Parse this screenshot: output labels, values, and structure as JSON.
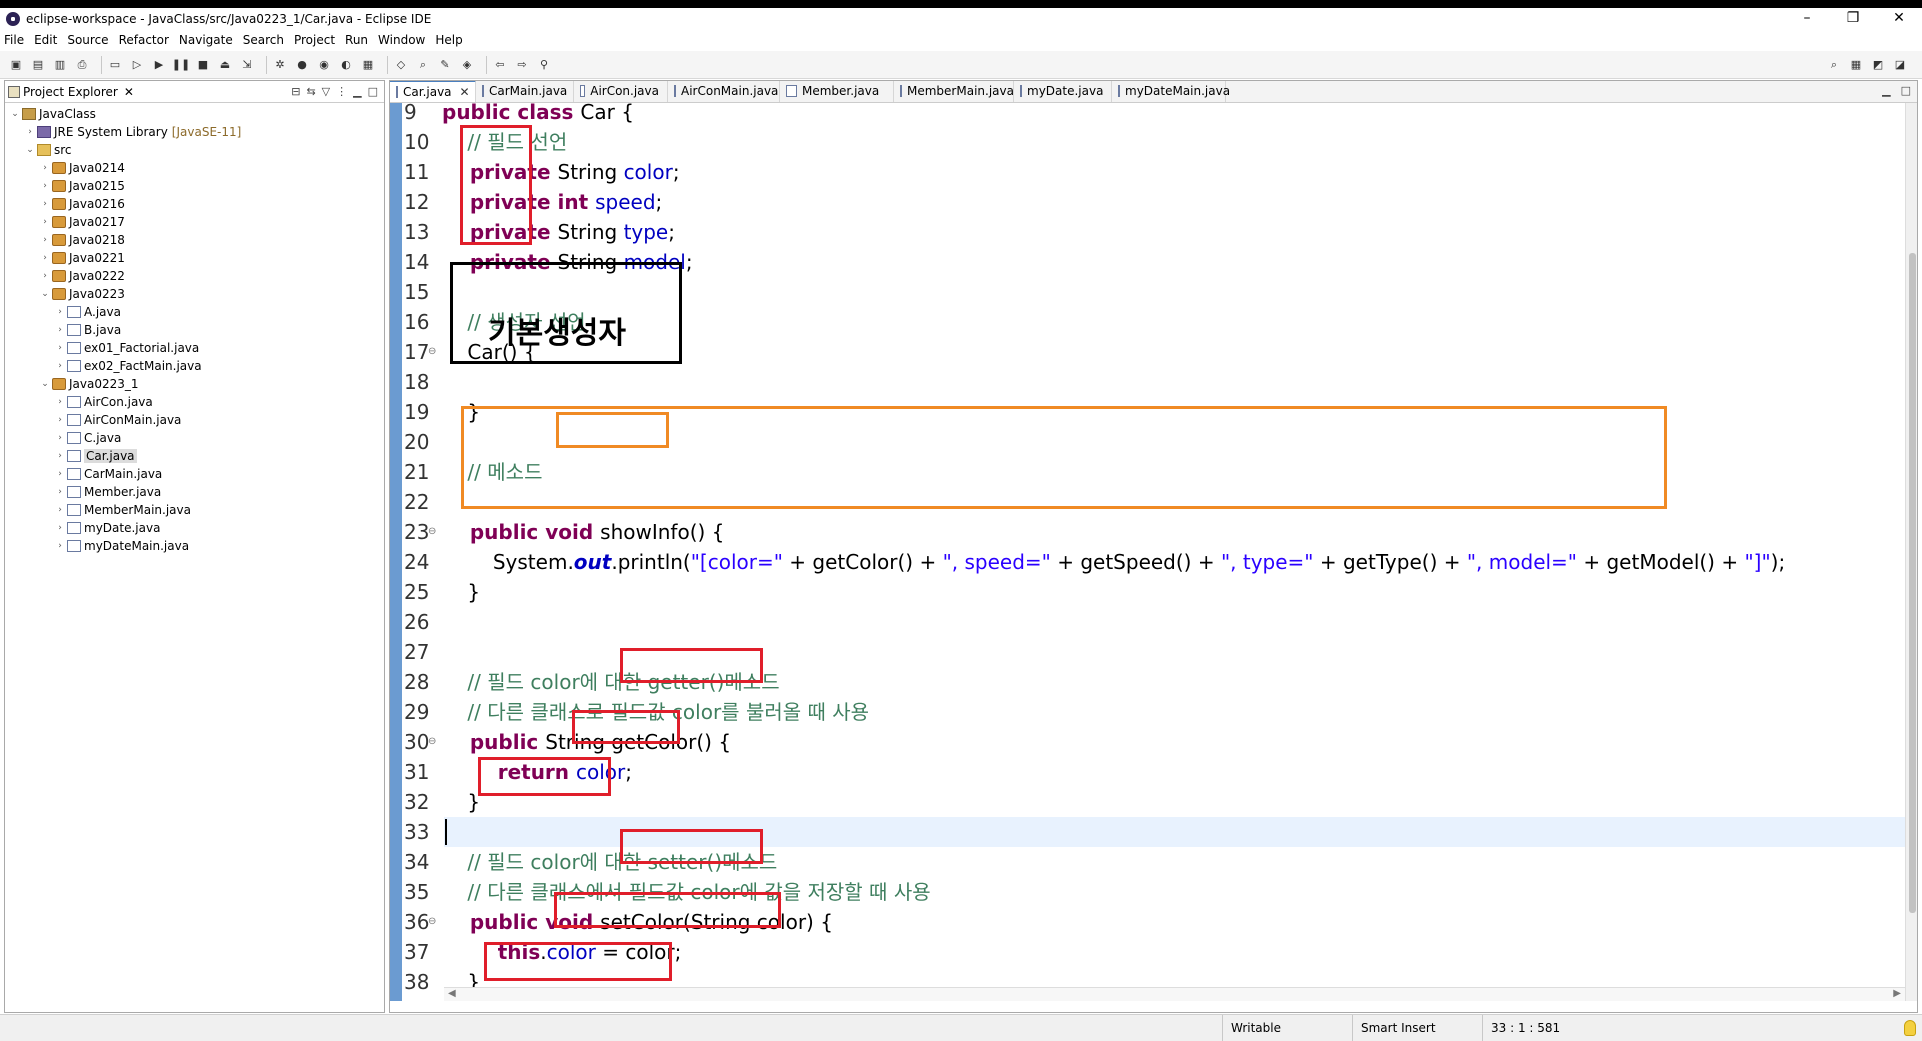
{
  "window": {
    "title": "eclipse-workspace - JavaClass/src/Java0223_1/Car.java - Eclipse IDE",
    "minimize": "–",
    "maximize": "❐",
    "close": "✕"
  },
  "menu": [
    "File",
    "Edit",
    "Source",
    "Refactor",
    "Navigate",
    "Search",
    "Project",
    "Run",
    "Window",
    "Help"
  ],
  "toolbar_icons": [
    "new-icon",
    "save-icon",
    "save-all-icon",
    "print-icon",
    "terminal-icon",
    "skip-icon",
    "resume-icon",
    "suspend-icon",
    "terminate-icon",
    "disconnect-icon",
    "step-icon",
    "debug-icon",
    "run-icon",
    "coverage-icon",
    "external-tools-icon",
    "new-java-project-icon",
    "open-type-icon",
    "search-icon",
    "toggle-mark-icon",
    "annotation-icon",
    "back-icon",
    "forward-icon",
    "pin-icon"
  ],
  "explorer": {
    "title": "Project Explorer",
    "tree": [
      {
        "label": "JavaClass",
        "depth": 0,
        "icon": "proj",
        "arrow": "v"
      },
      {
        "label": "JRE System Library",
        "decor": "[JavaSE-11]",
        "depth": 1,
        "icon": "lib",
        "arrow": ">"
      },
      {
        "label": "src",
        "depth": 1,
        "icon": "folder",
        "arrow": "v"
      },
      {
        "label": "Java0214",
        "depth": 2,
        "icon": "pkg",
        "arrow": ">"
      },
      {
        "label": "Java0215",
        "depth": 2,
        "icon": "pkg",
        "arrow": ">"
      },
      {
        "label": "Java0216",
        "depth": 2,
        "icon": "pkg",
        "arrow": ">"
      },
      {
        "label": "Java0217",
        "depth": 2,
        "icon": "pkg",
        "arrow": ">"
      },
      {
        "label": "Java0218",
        "depth": 2,
        "icon": "pkg",
        "arrow": ">"
      },
      {
        "label": "Java0221",
        "depth": 2,
        "icon": "pkg",
        "arrow": ">"
      },
      {
        "label": "Java0222",
        "depth": 2,
        "icon": "pkg",
        "arrow": ">"
      },
      {
        "label": "Java0223",
        "depth": 2,
        "icon": "pkg",
        "arrow": "v"
      },
      {
        "label": "A.java",
        "depth": 3,
        "icon": "jfile",
        "arrow": ">"
      },
      {
        "label": "B.java",
        "depth": 3,
        "icon": "jfile",
        "arrow": ">"
      },
      {
        "label": "ex01_Factorial.java",
        "depth": 3,
        "icon": "jfile",
        "arrow": ">"
      },
      {
        "label": "ex02_FactMain.java",
        "depth": 3,
        "icon": "jfile",
        "arrow": ">"
      },
      {
        "label": "Java0223_1",
        "depth": 2,
        "icon": "pkg",
        "arrow": "v"
      },
      {
        "label": "AirCon.java",
        "depth": 3,
        "icon": "jfile",
        "arrow": ">"
      },
      {
        "label": "AirConMain.java",
        "depth": 3,
        "icon": "jfile",
        "arrow": ">"
      },
      {
        "label": "C.java",
        "depth": 3,
        "icon": "jfile",
        "arrow": ">"
      },
      {
        "label": "Car.java",
        "depth": 3,
        "icon": "jfile",
        "arrow": ">",
        "selected": true
      },
      {
        "label": "CarMain.java",
        "depth": 3,
        "icon": "jfile",
        "arrow": ">"
      },
      {
        "label": "Member.java",
        "depth": 3,
        "icon": "jfile",
        "arrow": ">"
      },
      {
        "label": "MemberMain.java",
        "depth": 3,
        "icon": "jfile",
        "arrow": ">"
      },
      {
        "label": "myDate.java",
        "depth": 3,
        "icon": "jfile",
        "arrow": ">"
      },
      {
        "label": "myDateMain.java",
        "depth": 3,
        "icon": "jfile",
        "arrow": ">"
      }
    ]
  },
  "tabs": [
    {
      "label": "Car.java",
      "active": true
    },
    {
      "label": "CarMain.java"
    },
    {
      "label": "AirCon.java"
    },
    {
      "label": "AirConMain.java"
    },
    {
      "label": "Member.java"
    },
    {
      "label": "MemberMain.java"
    },
    {
      "label": "myDate.java"
    },
    {
      "label": "myDateMain.java"
    }
  ],
  "code": [
    {
      "n": "9",
      "segs": [
        [
          "kw",
          "public class "
        ],
        [
          "plain",
          "Car {"
        ]
      ]
    },
    {
      "n": "10",
      "segs": [
        [
          "cm",
          "    // 필드 선언"
        ]
      ]
    },
    {
      "n": "11",
      "segs": [
        [
          "kw",
          "    private "
        ],
        [
          "plain",
          "String "
        ],
        [
          "fld",
          "color"
        ],
        [
          "plain",
          ";"
        ]
      ]
    },
    {
      "n": "12",
      "segs": [
        [
          "kw",
          "    private int "
        ],
        [
          "fld",
          "speed"
        ],
        [
          "plain",
          ";"
        ]
      ]
    },
    {
      "n": "13",
      "segs": [
        [
          "kw",
          "    private "
        ],
        [
          "plain",
          "String "
        ],
        [
          "fld",
          "type"
        ],
        [
          "plain",
          ";"
        ]
      ]
    },
    {
      "n": "14",
      "segs": [
        [
          "kw",
          "    private "
        ],
        [
          "plain",
          "String "
        ],
        [
          "fld",
          "model"
        ],
        [
          "plain",
          ";"
        ]
      ]
    },
    {
      "n": "15",
      "segs": []
    },
    {
      "n": "16",
      "segs": [
        [
          "cm",
          "    // 생성자 선언"
        ]
      ]
    },
    {
      "n": "17",
      "fold": true,
      "segs": [
        [
          "plain",
          "    Car() {"
        ]
      ]
    },
    {
      "n": "18",
      "segs": []
    },
    {
      "n": "19",
      "segs": [
        [
          "plain",
          "    }"
        ]
      ]
    },
    {
      "n": "20",
      "segs": []
    },
    {
      "n": "21",
      "segs": [
        [
          "cm",
          "    // 메소드"
        ]
      ]
    },
    {
      "n": "22",
      "segs": []
    },
    {
      "n": "23",
      "fold": true,
      "segs": [
        [
          "kw",
          "    public void "
        ],
        [
          "plain",
          "showInfo() {"
        ]
      ]
    },
    {
      "n": "24",
      "segs": [
        [
          "plain",
          "        System."
        ],
        [
          "st",
          "out"
        ],
        [
          "plain",
          ".println("
        ],
        [
          "str",
          "\"[color=\""
        ],
        [
          "plain",
          " + getColor() + "
        ],
        [
          "str",
          "\", speed=\""
        ],
        [
          "plain",
          " + getSpeed() + "
        ],
        [
          "str",
          "\", type=\""
        ],
        [
          "plain",
          " + getType() + "
        ],
        [
          "str",
          "\", model=\""
        ],
        [
          "plain",
          " + getModel() + "
        ],
        [
          "str",
          "\"]\""
        ],
        [
          "plain",
          ");"
        ]
      ]
    },
    {
      "n": "25",
      "segs": [
        [
          "plain",
          "    }"
        ]
      ]
    },
    {
      "n": "26",
      "segs": []
    },
    {
      "n": "27",
      "segs": []
    },
    {
      "n": "28",
      "segs": [
        [
          "cm",
          "    // 필드 color에 대한 getter()메소드"
        ]
      ]
    },
    {
      "n": "29",
      "segs": [
        [
          "cm",
          "    // 다른 클래스로 필드값 color를 불러올 때 사용"
        ]
      ]
    },
    {
      "n": "30",
      "fold": true,
      "segs": [
        [
          "kw",
          "    public "
        ],
        [
          "plain",
          "String getColor() {"
        ]
      ]
    },
    {
      "n": "31",
      "segs": [
        [
          "kw",
          "        return "
        ],
        [
          "fld",
          "color"
        ],
        [
          "plain",
          ";"
        ]
      ]
    },
    {
      "n": "32",
      "segs": [
        [
          "plain",
          "    }"
        ]
      ]
    },
    {
      "n": "33",
      "segs": [],
      "current": true
    },
    {
      "n": "34",
      "segs": [
        [
          "cm",
          "    // 필드 color에 대한 setter()메소드"
        ]
      ]
    },
    {
      "n": "35",
      "segs": [
        [
          "cm",
          "    // 다른 클래스에서 필드값 color에 값을 저장할 때 사용"
        ]
      ]
    },
    {
      "n": "36",
      "fold": true,
      "segs": [
        [
          "kw",
          "    public void "
        ],
        [
          "plain",
          "setColor(String color) {"
        ]
      ]
    },
    {
      "n": "37",
      "segs": [
        [
          "kw",
          "        this"
        ],
        [
          "plain",
          "."
        ],
        [
          "fld",
          "color"
        ],
        [
          "plain",
          " = color;"
        ]
      ]
    },
    {
      "n": "38",
      "segs": [
        [
          "plain",
          "    }"
        ]
      ]
    }
  ],
  "annotation": {
    "constructor_label": "기본생성자"
  },
  "status": {
    "mode": "Writable",
    "insert": "Smart Insert",
    "position": "33 : 1 : 581"
  }
}
